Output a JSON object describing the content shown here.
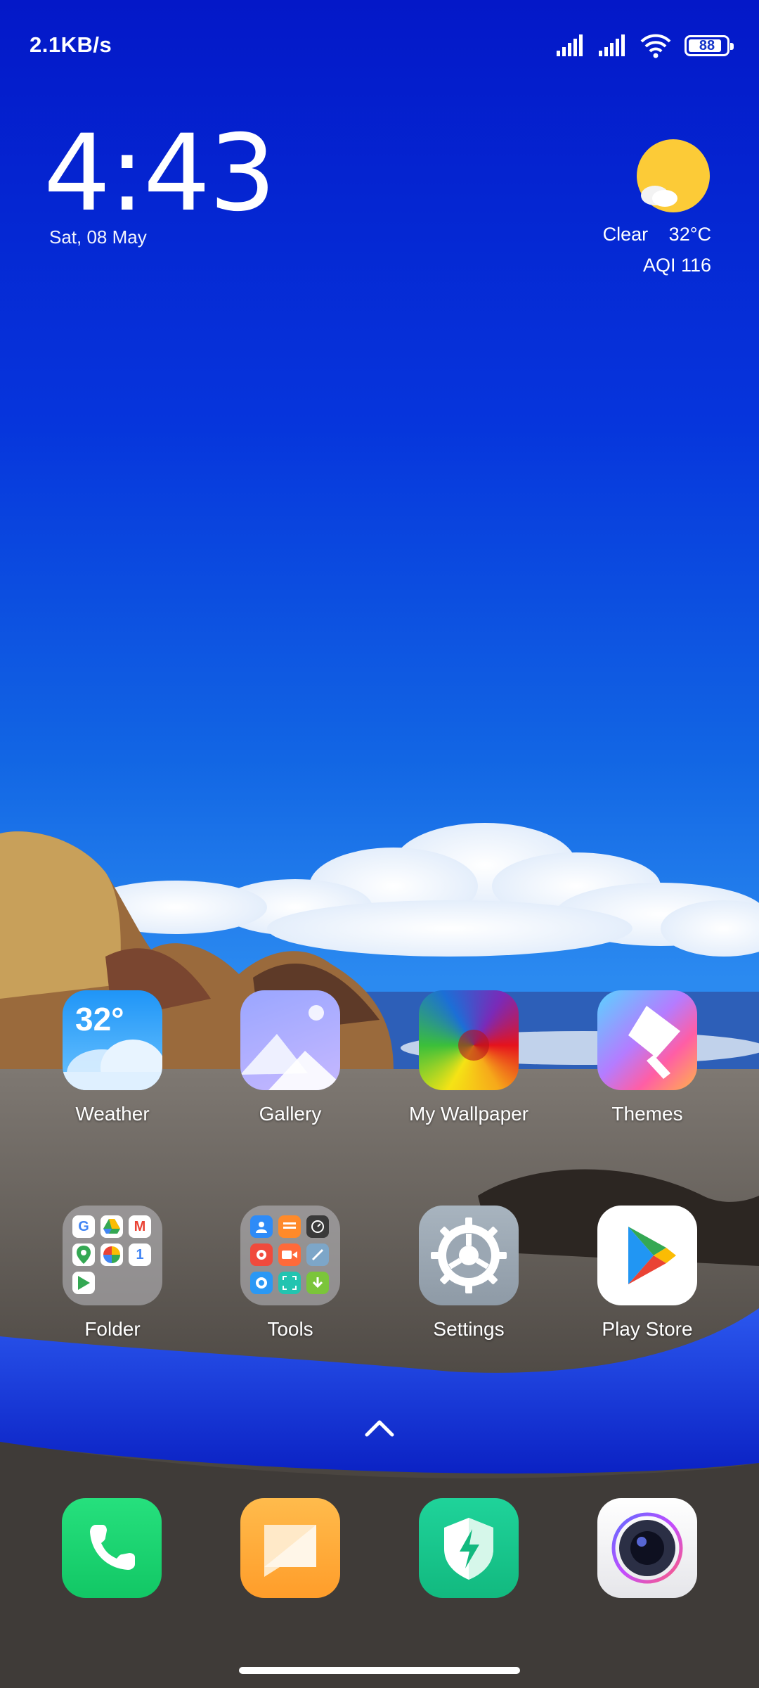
{
  "status_bar": {
    "net_speed": "2.1KB/s",
    "battery_level": "88",
    "battery_fraction": 0.88,
    "icons": [
      "signal-sim1-icon",
      "signal-sim2-icon",
      "wifi-icon",
      "battery-icon"
    ]
  },
  "clock_widget": {
    "time": "4:43",
    "date": "Sat, 08 May"
  },
  "weather_widget": {
    "condition": "Clear",
    "temperature": "32°C",
    "aqi": "AQI 116",
    "icon": "sun-cloud-icon"
  },
  "apps": [
    {
      "label": "Weather",
      "icon": "weather-app-icon",
      "badge_text": "32°"
    },
    {
      "label": "Gallery",
      "icon": "gallery-app-icon"
    },
    {
      "label": "My Wallpaper",
      "icon": "wallpaper-app-icon"
    },
    {
      "label": "Themes",
      "icon": "themes-app-icon"
    },
    {
      "label": "Folder",
      "icon": "google-folder-icon"
    },
    {
      "label": "Tools",
      "icon": "tools-folder-icon"
    },
    {
      "label": "Settings",
      "icon": "settings-gear-icon"
    },
    {
      "label": "Play Store",
      "icon": "play-store-icon"
    }
  ],
  "dock": [
    "phone-icon",
    "notes-icon",
    "security-icon",
    "camera-icon"
  ],
  "colors": {
    "sky_top": "#0418c8",
    "sky_mid": "#1a6fe8",
    "sand": "#5a5550",
    "water": "#1c3fe0"
  }
}
